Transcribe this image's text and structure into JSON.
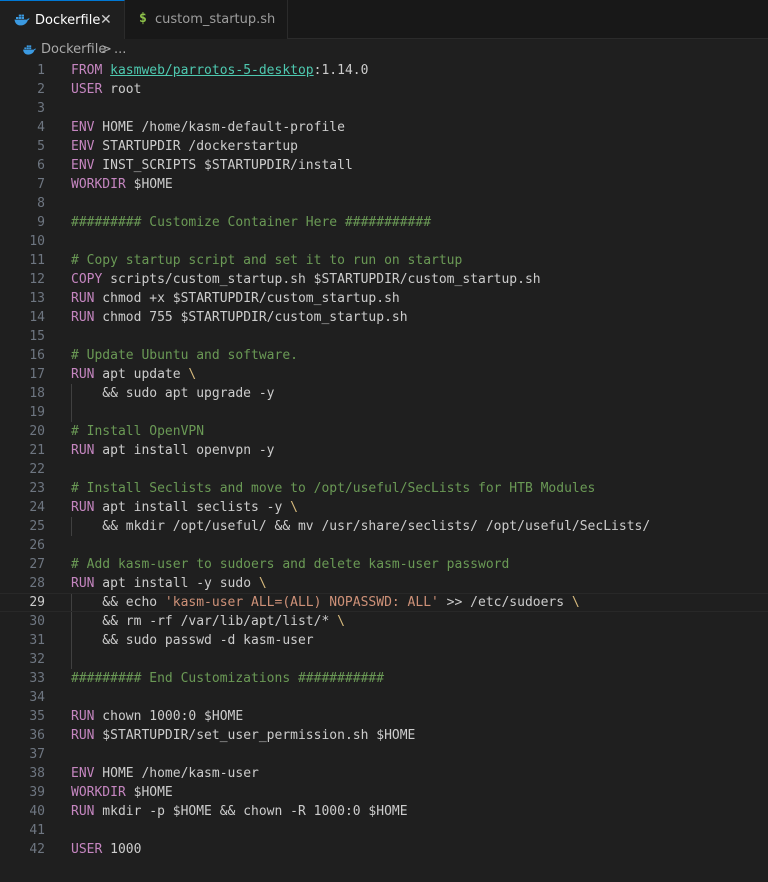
{
  "tabs": [
    {
      "label": "Dockerfile",
      "icon": "docker-icon",
      "active": true,
      "close": "✕"
    },
    {
      "label": "custom_startup.sh",
      "icon": "dollar-icon",
      "icon_glyph": "$",
      "active": false
    }
  ],
  "breadcrumb": {
    "file": "Dockerfile",
    "separator": ">",
    "more": "..."
  },
  "editor": {
    "current_line": 29,
    "colors": {
      "keyword": "#c586c0",
      "text": "#cccccc",
      "comment": "#6a9955",
      "string": "#ce9178",
      "link": "#4ec9b0",
      "escape": "#d7ba7d",
      "number": "#b5cea8",
      "variable": "#9cdcfe",
      "active_tab_border": "#0078d4"
    },
    "lines": [
      {
        "n": "1",
        "tokens": [
          {
            "t": "FROM",
            "c": "keyword"
          },
          {
            "t": " ",
            "c": "text"
          },
          {
            "t": "kasmweb/parrotos-5-desktop",
            "c": "link"
          },
          {
            "t": ":1.14.0",
            "c": "text"
          }
        ]
      },
      {
        "n": "2",
        "tokens": [
          {
            "t": "USER",
            "c": "keyword"
          },
          {
            "t": " root",
            "c": "text"
          }
        ]
      },
      {
        "n": "3",
        "tokens": []
      },
      {
        "n": "4",
        "tokens": [
          {
            "t": "ENV",
            "c": "keyword"
          },
          {
            "t": " HOME /home/kasm-default-profile",
            "c": "text"
          }
        ]
      },
      {
        "n": "5",
        "tokens": [
          {
            "t": "ENV",
            "c": "keyword"
          },
          {
            "t": " STARTUPDIR /dockerstartup",
            "c": "text"
          }
        ]
      },
      {
        "n": "6",
        "tokens": [
          {
            "t": "ENV",
            "c": "keyword"
          },
          {
            "t": " INST_SCRIPTS $STARTUPDIR/install",
            "c": "text"
          }
        ]
      },
      {
        "n": "7",
        "tokens": [
          {
            "t": "WORKDIR",
            "c": "keyword"
          },
          {
            "t": " $HOME",
            "c": "text"
          }
        ]
      },
      {
        "n": "8",
        "tokens": []
      },
      {
        "n": "9",
        "tokens": [
          {
            "t": "######### Customize Container Here ###########",
            "c": "comment"
          }
        ]
      },
      {
        "n": "10",
        "tokens": []
      },
      {
        "n": "11",
        "tokens": [
          {
            "t": "# Copy startup script and set it to run on startup",
            "c": "comment"
          }
        ]
      },
      {
        "n": "12",
        "tokens": [
          {
            "t": "COPY",
            "c": "keyword"
          },
          {
            "t": " scripts/custom_startup.sh $STARTUPDIR/custom_startup.sh",
            "c": "text"
          }
        ]
      },
      {
        "n": "13",
        "tokens": [
          {
            "t": "RUN",
            "c": "keyword"
          },
          {
            "t": " chmod +x $STARTUPDIR/custom_startup.sh",
            "c": "text"
          }
        ]
      },
      {
        "n": "14",
        "tokens": [
          {
            "t": "RUN",
            "c": "keyword"
          },
          {
            "t": " chmod 755 $STARTUPDIR/custom_startup.sh",
            "c": "text"
          }
        ]
      },
      {
        "n": "15",
        "tokens": []
      },
      {
        "n": "16",
        "tokens": [
          {
            "t": "# Update Ubuntu and software.",
            "c": "comment"
          }
        ]
      },
      {
        "n": "17",
        "tokens": [
          {
            "t": "RUN",
            "c": "keyword"
          },
          {
            "t": " apt update ",
            "c": "text"
          },
          {
            "t": "\\",
            "c": "escape"
          }
        ]
      },
      {
        "n": "18",
        "tokens": [
          {
            "t": "    && sudo apt upgrade -y",
            "c": "text"
          }
        ]
      },
      {
        "n": "19",
        "tokens": []
      },
      {
        "n": "20",
        "tokens": [
          {
            "t": "# Install OpenVPN",
            "c": "comment"
          }
        ]
      },
      {
        "n": "21",
        "tokens": [
          {
            "t": "RUN",
            "c": "keyword"
          },
          {
            "t": " apt install openvpn -y",
            "c": "text"
          }
        ]
      },
      {
        "n": "22",
        "tokens": []
      },
      {
        "n": "23",
        "tokens": [
          {
            "t": "# Install Seclists and move to /opt/useful/SecLists for HTB Modules",
            "c": "comment"
          }
        ]
      },
      {
        "n": "24",
        "tokens": [
          {
            "t": "RUN",
            "c": "keyword"
          },
          {
            "t": " apt install seclists -y ",
            "c": "text"
          },
          {
            "t": "\\",
            "c": "escape"
          }
        ]
      },
      {
        "n": "25",
        "tokens": [
          {
            "t": "    && mkdir /opt/useful/ && mv /usr/share/seclists/ /opt/useful/SecLists/",
            "c": "text"
          }
        ]
      },
      {
        "n": "26",
        "tokens": []
      },
      {
        "n": "27",
        "tokens": [
          {
            "t": "# Add kasm-user to sudoers and delete kasm-user password",
            "c": "comment"
          }
        ]
      },
      {
        "n": "28",
        "tokens": [
          {
            "t": "RUN",
            "c": "keyword"
          },
          {
            "t": " apt install -y sudo ",
            "c": "text"
          },
          {
            "t": "\\",
            "c": "escape"
          }
        ]
      },
      {
        "n": "29",
        "tokens": [
          {
            "t": "    && echo ",
            "c": "text"
          },
          {
            "t": "'kasm-user ALL=(ALL) NOPASSWD: ALL'",
            "c": "string"
          },
          {
            "t": " >> /etc/sudoers ",
            "c": "text"
          },
          {
            "t": "\\",
            "c": "escape"
          }
        ]
      },
      {
        "n": "30",
        "tokens": [
          {
            "t": "    && rm -rf /var/lib/apt/list/* ",
            "c": "text"
          },
          {
            "t": "\\",
            "c": "escape"
          }
        ]
      },
      {
        "n": "31",
        "tokens": [
          {
            "t": "    && sudo passwd -d kasm-user",
            "c": "text"
          }
        ]
      },
      {
        "n": "32",
        "tokens": []
      },
      {
        "n": "33",
        "tokens": [
          {
            "t": "######### End Customizations ###########",
            "c": "comment"
          }
        ]
      },
      {
        "n": "34",
        "tokens": []
      },
      {
        "n": "35",
        "tokens": [
          {
            "t": "RUN",
            "c": "keyword"
          },
          {
            "t": " chown 1000:0 $HOME",
            "c": "text"
          }
        ]
      },
      {
        "n": "36",
        "tokens": [
          {
            "t": "RUN",
            "c": "keyword"
          },
          {
            "t": " $STARTUPDIR/set_user_permission.sh $HOME",
            "c": "text"
          }
        ]
      },
      {
        "n": "37",
        "tokens": []
      },
      {
        "n": "38",
        "tokens": [
          {
            "t": "ENV",
            "c": "keyword"
          },
          {
            "t": " HOME /home/kasm-user",
            "c": "text"
          }
        ]
      },
      {
        "n": "39",
        "tokens": [
          {
            "t": "WORKDIR",
            "c": "keyword"
          },
          {
            "t": " $HOME",
            "c": "text"
          }
        ]
      },
      {
        "n": "40",
        "tokens": [
          {
            "t": "RUN",
            "c": "keyword"
          },
          {
            "t": " mkdir -p $HOME && chown -R 1000:0 $HOME",
            "c": "text"
          }
        ]
      },
      {
        "n": "41",
        "tokens": []
      },
      {
        "n": "42",
        "tokens": [
          {
            "t": "USER",
            "c": "keyword"
          },
          {
            "t": " 1000",
            "c": "text"
          }
        ]
      }
    ]
  }
}
